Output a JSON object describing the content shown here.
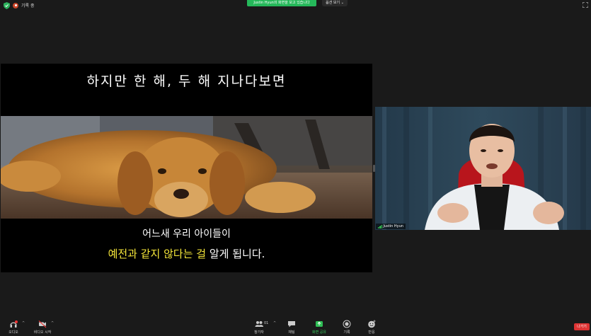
{
  "topbar": {
    "recording_label": "기록 중",
    "share_banner": "Justin Hyun의 화면을 보고 있습니다",
    "view_options": "옵션 보기 ⌄"
  },
  "slide": {
    "title": "하지만 한 해, 두 해 지나다보면",
    "line1": "어느새 우리 아이들이",
    "line2_part1": "예전과 ",
    "line2_part2": "같지 않다는 걸",
    "line2_part3": " 알게 됩니다."
  },
  "participant": {
    "name": "Justin Hyun"
  },
  "toolbar": {
    "audio": "오디오",
    "video": "비디오 시작",
    "participants": "참가자",
    "participants_count": "01",
    "chat": "채팅",
    "share": "화면 공유",
    "record": "기록",
    "reactions": "반응",
    "leave": "나가기"
  },
  "colors": {
    "banner_green": "#25b85a",
    "highlight_yellow": "#f7e83a",
    "leave_red": "#dd3333"
  }
}
